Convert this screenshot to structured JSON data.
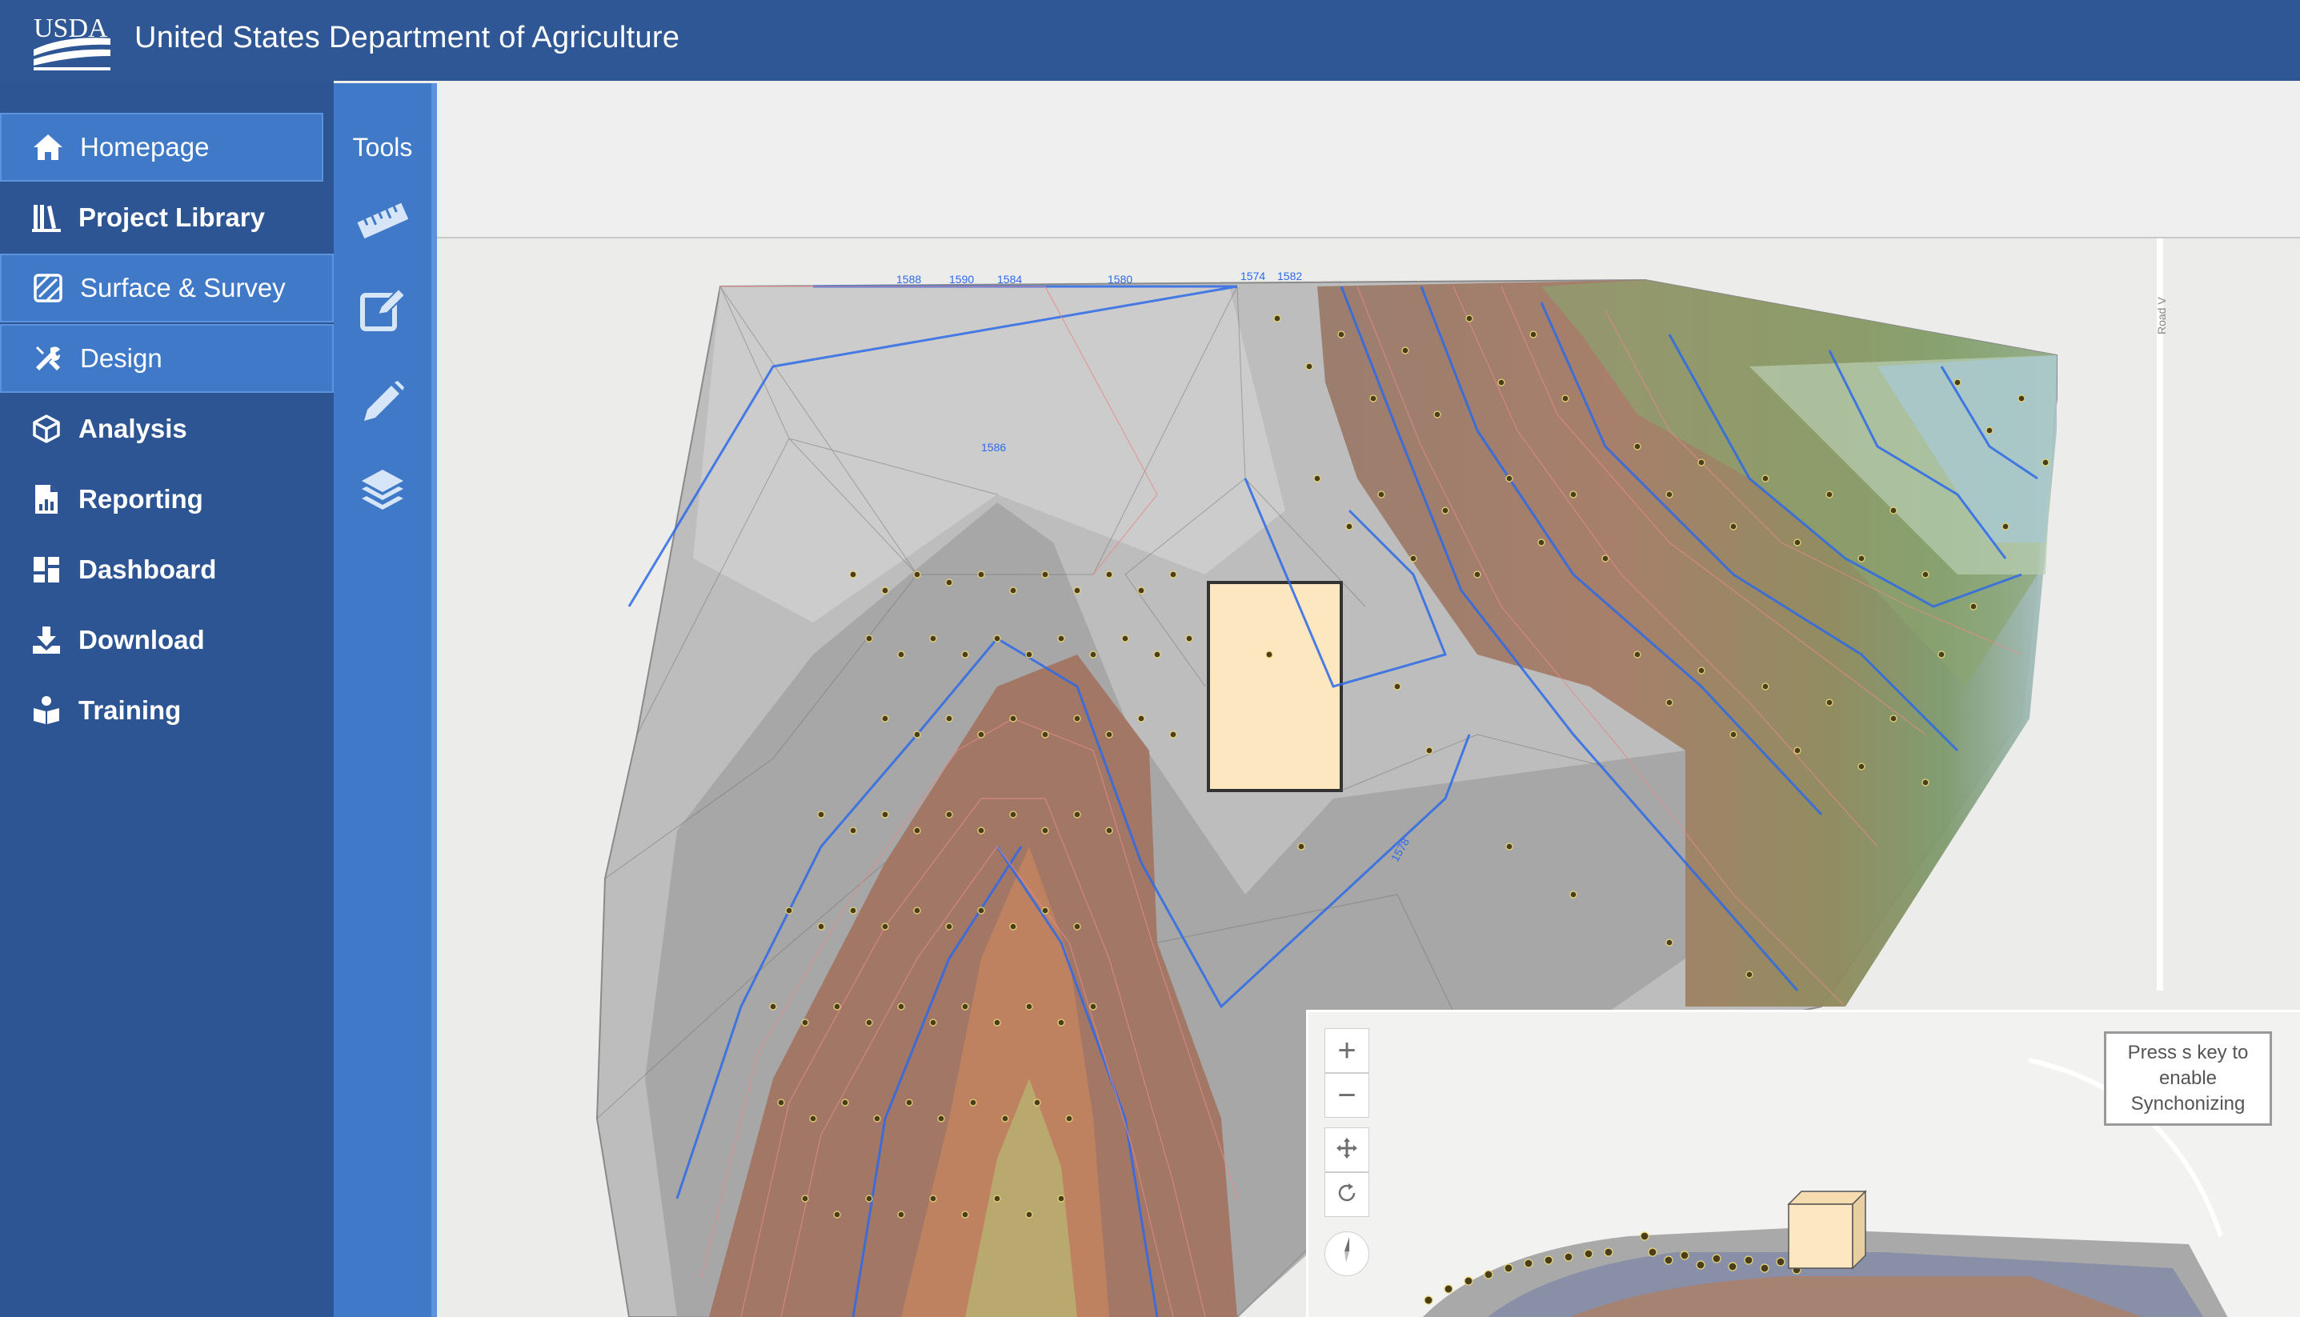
{
  "header": {
    "logo_text": "USDA",
    "agency_name": "United States Department of Agriculture"
  },
  "sidebar": {
    "items": [
      {
        "label": "Homepage",
        "icon": "home-icon"
      },
      {
        "label": "Project Library",
        "icon": "library-icon"
      },
      {
        "label": "Surface & Survey",
        "icon": "surface-icon"
      },
      {
        "label": "Design",
        "icon": "tools-icon"
      },
      {
        "label": "Analysis",
        "icon": "cube-icon"
      },
      {
        "label": "Reporting",
        "icon": "report-icon"
      },
      {
        "label": "Dashboard",
        "icon": "dashboard-icon"
      },
      {
        "label": "Download",
        "icon": "download-icon"
      },
      {
        "label": "Training",
        "icon": "training-icon"
      }
    ]
  },
  "tools": {
    "title": "Tools",
    "buttons": [
      "ruler-icon",
      "edit-icon",
      "pencil-icon",
      "layers-icon"
    ]
  },
  "map": {
    "contour_labels": [
      "1588",
      "1590",
      "1584",
      "1580",
      "1574",
      "1582",
      "1586",
      "1578"
    ],
    "road_label": "Road V"
  },
  "inset": {
    "zoom_in": "+",
    "zoom_out": "−",
    "sync_message": "Press s key to enable Synchonizing"
  },
  "colors": {
    "header_bg": "#2f5795",
    "sidebar_bg": "#2e5593",
    "active_bg": "#3f79c7",
    "structure_fill": "#fde7c0"
  }
}
